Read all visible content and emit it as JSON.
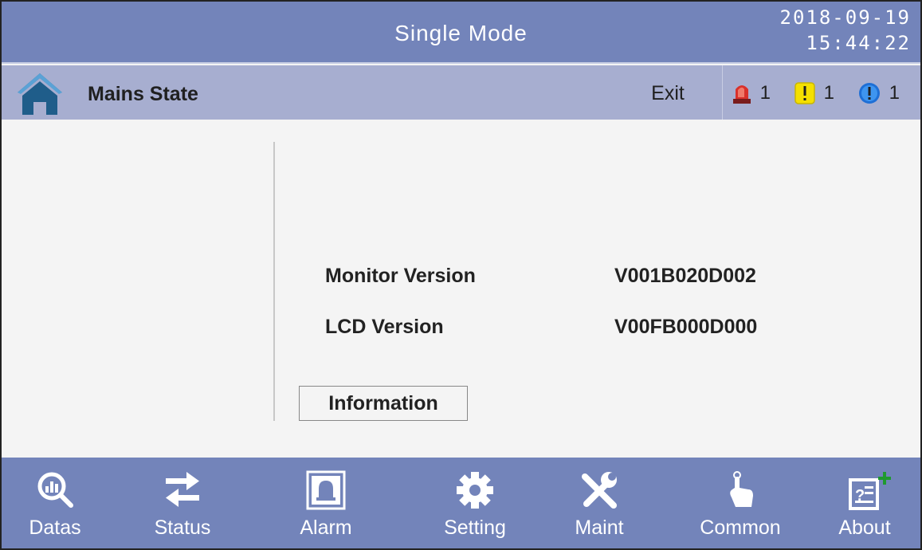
{
  "titlebar": {
    "title": "Single Mode",
    "date": "2018-09-19",
    "time": "15:44:22"
  },
  "subbar": {
    "home_icon": "home-icon",
    "state": "Mains State",
    "exit_label": "Exit"
  },
  "alarms": [
    {
      "icon": "siren-icon",
      "count": "1",
      "color": "#d9312b"
    },
    {
      "icon": "warning-icon",
      "count": "1",
      "color": "#f4e000"
    },
    {
      "icon": "info-icon",
      "count": "1",
      "color": "#1e6fd6"
    }
  ],
  "main": {
    "rows": [
      {
        "label": "Monitor Version",
        "value": "V001B020D002"
      },
      {
        "label": "LCD Version",
        "value": "V00FB000D000"
      }
    ],
    "info_button": "Information"
  },
  "nav": {
    "items": [
      {
        "icon": "datas-icon",
        "label": "Datas"
      },
      {
        "icon": "status-icon",
        "label": "Status"
      },
      {
        "icon": "alarm-icon",
        "label": "Alarm"
      },
      {
        "icon": "setting-icon",
        "label": "Setting"
      },
      {
        "icon": "maint-icon",
        "label": "Maint"
      },
      {
        "icon": "common-icon",
        "label": "Common"
      },
      {
        "icon": "about-icon",
        "label": "About"
      }
    ]
  },
  "colors": {
    "titlebar_bg": "#7384ba",
    "subbar_bg": "#a7aed0",
    "content_bg": "#f4f4f4",
    "home_icon": "#1f5d8a"
  }
}
